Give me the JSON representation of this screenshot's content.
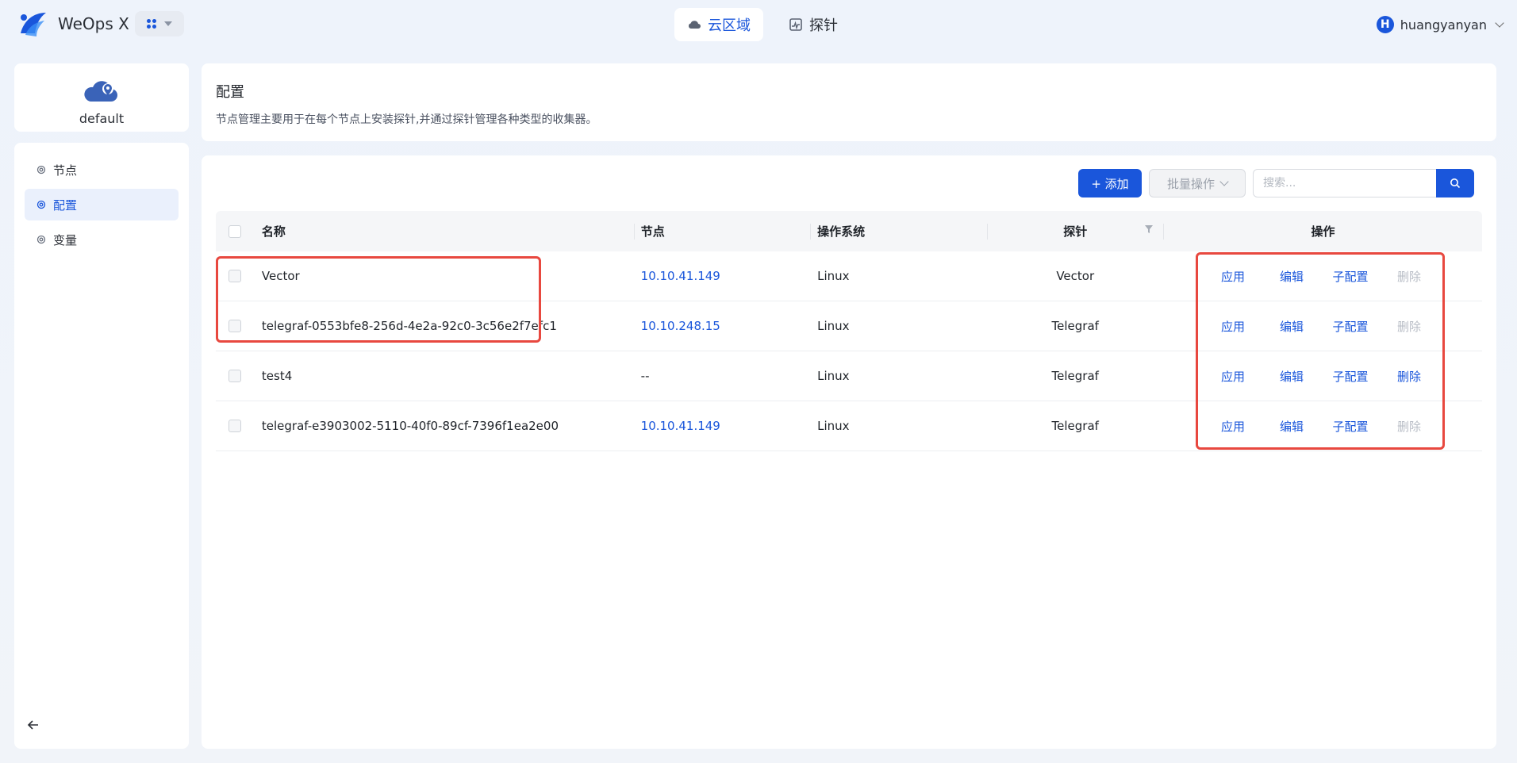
{
  "app": {
    "brand": "WeOps X"
  },
  "nav": {
    "tabs": [
      {
        "label": "云区域"
      },
      {
        "label": "探针"
      }
    ]
  },
  "user": {
    "initial": "H",
    "name": "huangyanyan"
  },
  "sidebar": {
    "cloud_name": "default",
    "items": [
      {
        "label": "节点"
      },
      {
        "label": "配置"
      },
      {
        "label": "变量"
      }
    ]
  },
  "header": {
    "title": "配置",
    "description": "节点管理主要用于在每个节点上安装探针,并通过探针管理各种类型的收集器。"
  },
  "toolbar": {
    "add_label": "+ 添加",
    "batch_label": "批量操作",
    "search_placeholder": "搜索..."
  },
  "table": {
    "columns": {
      "name": "名称",
      "node": "节点",
      "os": "操作系统",
      "probe": "探针",
      "ops": "操作"
    },
    "actions": {
      "apply": "应用",
      "edit": "编辑",
      "sub_config": "子配置",
      "delete": "删除"
    },
    "rows": [
      {
        "name": "Vector",
        "node": "10.10.41.149",
        "os": "Linux",
        "probe": "Vector"
      },
      {
        "name": "telegraf-0553bfe8-256d-4e2a-92c0-3c56e2f7efc1",
        "node": "10.10.248.15",
        "os": "Linux",
        "probe": "Telegraf"
      },
      {
        "name": "test4",
        "node": "--",
        "os": "Linux",
        "probe": "Telegraf"
      },
      {
        "name": "telegraf-e3903002-5110-40f0-89cf-7396f1ea2e00",
        "node": "10.10.41.149",
        "os": "Linux",
        "probe": "Telegraf"
      }
    ]
  },
  "colors": {
    "accent": "#1a56db",
    "highlight": "#e8483f",
    "disabled": "#b8bdc6"
  }
}
